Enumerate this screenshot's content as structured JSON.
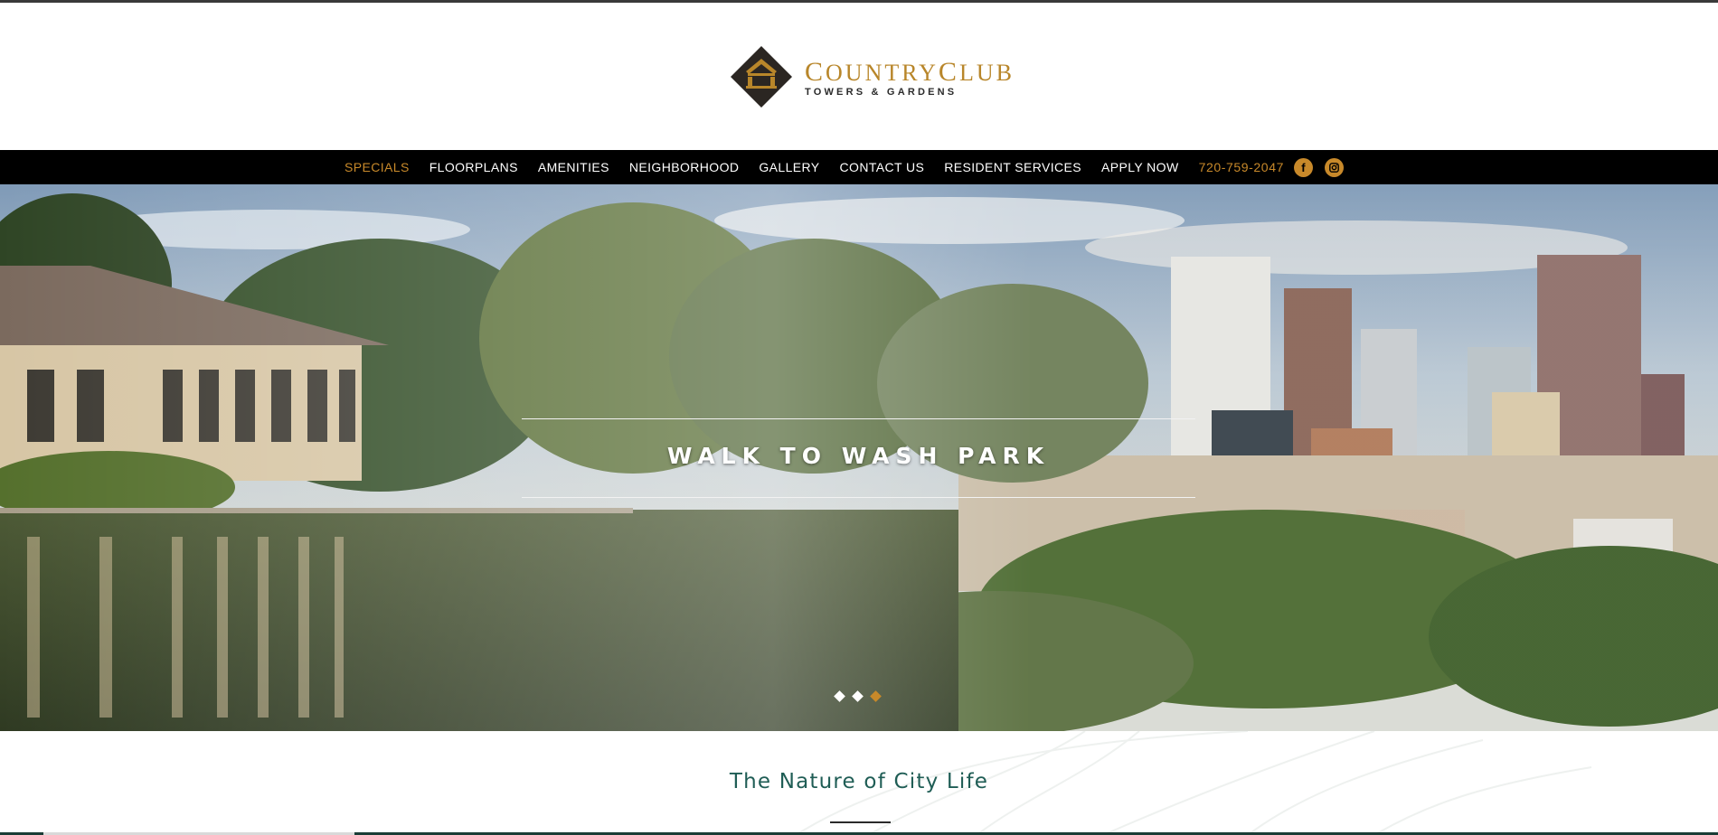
{
  "brand": {
    "name_first_initial": "C",
    "name_first_rest": "OUNTRY",
    "name_second_initial": "C",
    "name_second_rest": "LUB",
    "tagline": "TOWERS & GARDENS",
    "gold": "#b8862a",
    "dark": "#2b2b2b"
  },
  "nav": {
    "items": [
      {
        "label": "SPECIALS",
        "active": true
      },
      {
        "label": "FLOORPLANS",
        "active": false
      },
      {
        "label": "AMENITIES",
        "active": false
      },
      {
        "label": "NEIGHBORHOOD",
        "active": false
      },
      {
        "label": "GALLERY",
        "active": false
      },
      {
        "label": "CONTACT US",
        "active": false
      },
      {
        "label": "RESIDENT SERVICES",
        "active": false
      },
      {
        "label": "APPLY NOW",
        "active": false
      }
    ],
    "phone": "720-759-2047",
    "social": [
      {
        "icon": "facebook-icon",
        "glyph": "f"
      },
      {
        "icon": "instagram-icon",
        "glyph": "◙"
      }
    ],
    "accent": "#c8892a"
  },
  "hero": {
    "slide_title": "WALK TO WASH PARK",
    "slides_total": 3,
    "active_slide": 3
  },
  "intro": {
    "title": "The Nature of City Life"
  }
}
